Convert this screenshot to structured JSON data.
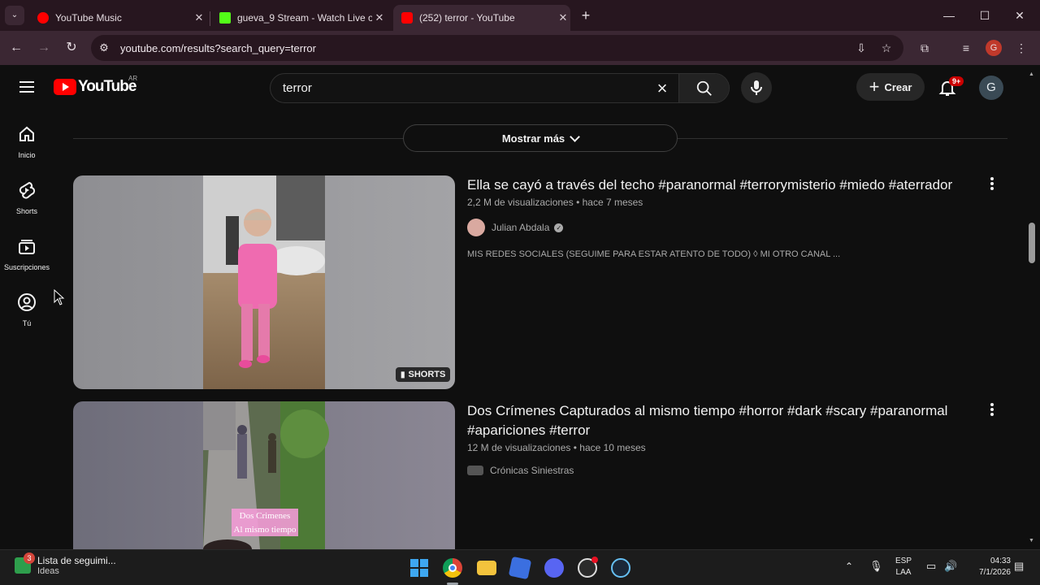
{
  "browser": {
    "tabs": [
      {
        "title": "YouTube Music",
        "favicon_color": "#ff0000"
      },
      {
        "title": "gueva_9 Stream - Watch Live o",
        "favicon_color": "#53fc18"
      },
      {
        "title": "(252) terror - YouTube",
        "favicon_color": "#ff0000"
      }
    ],
    "url": "youtube.com/results?search_query=terror",
    "profile_initial": "G"
  },
  "youtube": {
    "logo_text": "YouTube",
    "country_code": "AR",
    "search_value": "terror",
    "create_label": "Crear",
    "notification_badge": "9+",
    "avatar_initial": "G"
  },
  "sidebar": {
    "items": [
      {
        "label": "Inicio",
        "icon": "home-icon"
      },
      {
        "label": "Shorts",
        "icon": "shorts-icon"
      },
      {
        "label": "Suscripciones",
        "icon": "subscriptions-icon"
      },
      {
        "label": "Tú",
        "icon": "you-icon"
      }
    ]
  },
  "results": {
    "show_more_label": "Mostrar más",
    "videos": [
      {
        "title": "Ella se cayó a través del techo #paranormal #terrorymisterio #miedo #aterrador",
        "meta": "2,2 M de visualizaciones • hace 7 meses",
        "channel": "Julian Abdala",
        "verified": true,
        "description": "MIS REDES SOCIALES (SEGUIME PARA ESTAR ATENTO DE TODO) ◊ MI OTRO CANAL ...",
        "badge": "SHORTS"
      },
      {
        "title": "Dos Crímenes Capturados al mismo tiempo #horror #dark #scary #paranormal #apariciones #terror",
        "meta": "12 M de visualizaciones • hace 10 meses",
        "channel": "Crónicas Siniestras",
        "thumb_caption_1": "Dos Crimenes",
        "thumb_caption_2": "Al mismo tiempo"
      }
    ]
  },
  "taskbar": {
    "notification_title": "Lista de seguimi...",
    "notification_sub": "Ideas",
    "notification_count": "3",
    "lang_1": "ESP",
    "lang_2": "LAA",
    "time": "04:33",
    "date": "7/1/2026"
  }
}
